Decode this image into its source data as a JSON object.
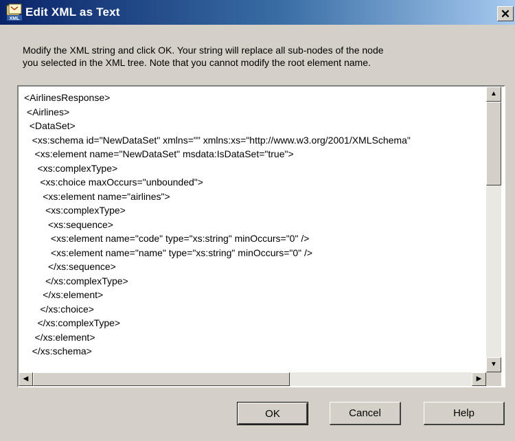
{
  "window": {
    "title": "Edit XML as Text",
    "icon_name": "xml-icon",
    "close_label": "✕"
  },
  "instructions": {
    "line1": "Modify the XML string and click OK.  Your string will replace all sub-nodes of the node",
    "line2": "you selected in the XML tree.  Note that you cannot modify the root element name."
  },
  "editor": {
    "lines": [
      "<AirlinesResponse>",
      " <Airlines>",
      "  <DataSet>",
      "   <xs:schema id=\"NewDataSet\" xmlns=\"\" xmlns:xs=\"http://www.w3.org/2001/XMLSchema\"",
      "    <xs:element name=\"NewDataSet\" msdata:IsDataSet=\"true\">",
      "     <xs:complexType>",
      "      <xs:choice maxOccurs=\"unbounded\">",
      "       <xs:element name=\"airlines\">",
      "        <xs:complexType>",
      "         <xs:sequence>",
      "          <xs:element name=\"code\" type=\"xs:string\" minOccurs=\"0\" />",
      "          <xs:element name=\"name\" type=\"xs:string\" minOccurs=\"0\" />",
      "         </xs:sequence>",
      "        </xs:complexType>",
      "       </xs:element>",
      "      </xs:choice>",
      "     </xs:complexType>",
      "    </xs:element>",
      "   </xs:schema>"
    ],
    "scroll_up_icon": "▲",
    "scroll_down_icon": "▼",
    "scroll_left_icon": "◀",
    "scroll_right_icon": "▶"
  },
  "buttons": {
    "ok": "OK",
    "cancel": "Cancel",
    "help": "Help"
  }
}
